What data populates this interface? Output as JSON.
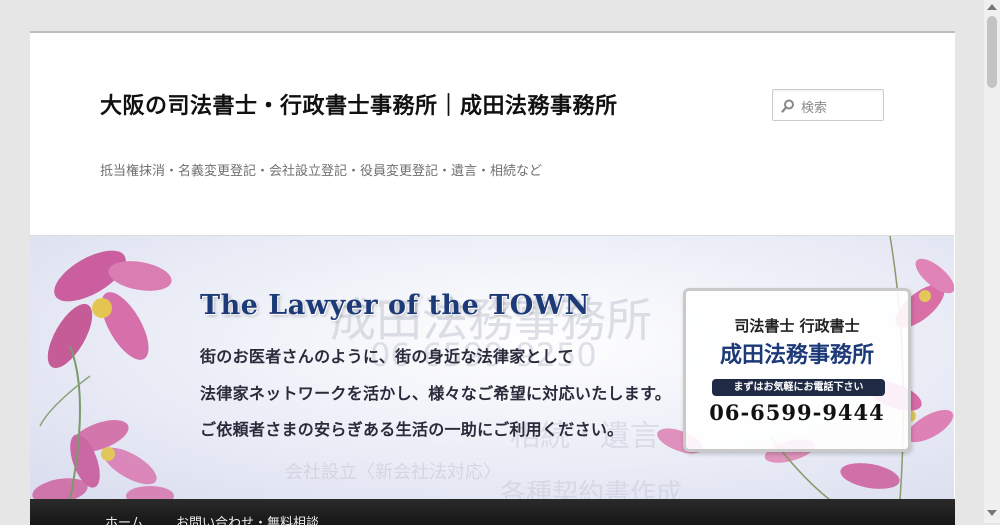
{
  "header": {
    "site_title": "大阪の司法書士・行政書士事務所｜成田法務事務所",
    "tagline": "抵当権抹消・名義変更登記・会社設立登記・役員変更登記・遺言・相続など"
  },
  "search": {
    "placeholder": "検索",
    "icon": "search-icon"
  },
  "banner": {
    "title": "The Lawyer of the TOWN",
    "lines": [
      "街のお医者さんのように、街の身近な法律家として",
      "法律家ネットワークを活かし、様々なご希望に対応いたします。",
      "ご依頼者さまの安らぎある生活の一助にご利用ください。"
    ],
    "card": {
      "subtitle": "司法書士 行政書士",
      "name": "成田法務事務所",
      "call_label": "まずはお気軽にお電話下さい",
      "phone": "06-6599-9444"
    },
    "watermark": {
      "office": "成田法務事務所",
      "phone": "06-6599-9250",
      "services_1": "相続・遺言",
      "services_2": "会社設立〈新会社法対応〉",
      "services_3": "各種契約書作成"
    }
  },
  "nav": {
    "items": [
      "ホーム",
      "お問い合わせ・無料相談"
    ]
  },
  "colors": {
    "page_bg": "#e6e6e6",
    "banner_title": "#1d3a78",
    "nav_bg": "#1b1b1b",
    "flower_pink": "#d0609a"
  }
}
